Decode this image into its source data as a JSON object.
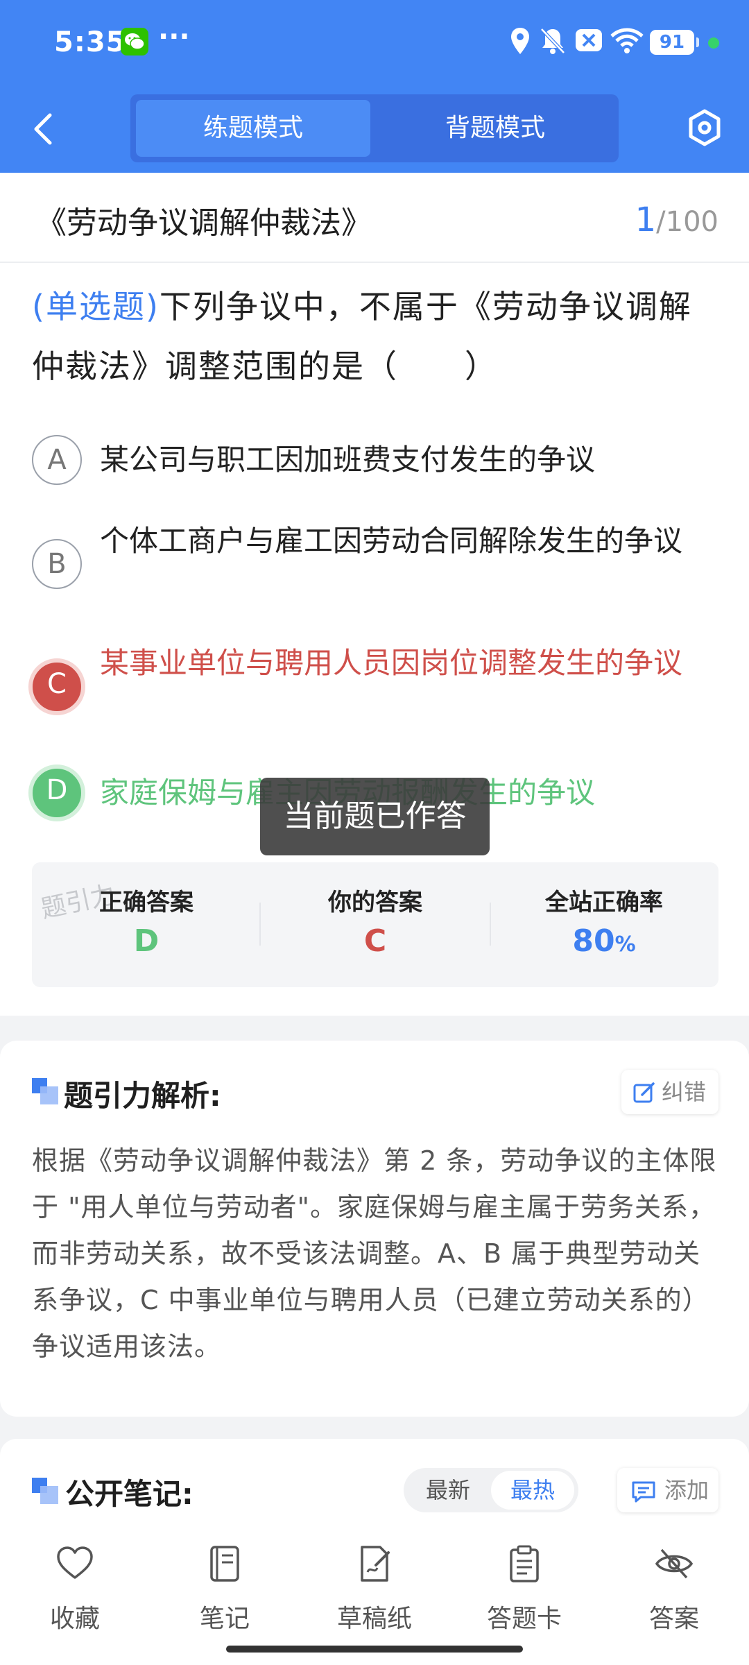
{
  "status_bar": {
    "time": "5:35",
    "more": "···",
    "battery": "91",
    "icons": [
      "wechat-icon",
      "location-icon",
      "mute-icon",
      "close-box-icon",
      "wifi-icon",
      "battery-icon"
    ]
  },
  "header": {
    "modes": [
      "练题模式",
      "背题模式"
    ],
    "active_mode": "练题模式"
  },
  "question": {
    "law_title": "《劳动争议调解仲裁法》",
    "current": "1",
    "total": "/100",
    "type_label": "(单选题)",
    "text": "下列争议中，不属于《劳动争议调解仲裁法》调整范围的是（　　）",
    "options": [
      {
        "letter": "A",
        "text": "某公司与职工因加班费支付发生的争议",
        "state": "normal"
      },
      {
        "letter": "B",
        "text": "个体工商户与雇工因劳动合同解除发生的争议",
        "state": "normal"
      },
      {
        "letter": "C",
        "text": "某事业单位与聘用人员因岗位调整发生的争议",
        "state": "wrong"
      },
      {
        "letter": "D",
        "text": "家庭保姆与雇主因劳动报酬发生的争议",
        "state": "correct"
      }
    ],
    "toast": "当前题已作答"
  },
  "result": {
    "watermark": "题引力",
    "correct_label": "正确答案",
    "correct_value": "D",
    "yours_label": "你的答案",
    "yours_value": "C",
    "rate_label": "全站正确率",
    "rate_value": "80",
    "rate_unit": "%"
  },
  "analysis": {
    "title": "题引力解析:",
    "fix_label": "纠错",
    "text": "根据《劳动争议调解仲裁法》第 2 条，劳动争议的主体限于 \"用人单位与劳动者\"。家庭保姆与雇主属于劳务关系，而非劳动关系，故不受该法调整。A、B 属于典型劳动关系争议，C 中事业单位与聘用人员（已建立劳动关系的）争议适用该法。"
  },
  "notes": {
    "title": "公开笔记:",
    "tabs": [
      "最新",
      "最热"
    ],
    "active_tab": "最热",
    "add_label": "添加"
  },
  "bottom_bar": {
    "items": [
      "收藏",
      "笔记",
      "草稿纸",
      "答题卡",
      "答案"
    ]
  },
  "colors": {
    "brand_blue": "#4285f4",
    "accent_blue": "#3e7ff0",
    "wrong_red": "#cf4f4a",
    "correct_green": "#5ec47c"
  }
}
